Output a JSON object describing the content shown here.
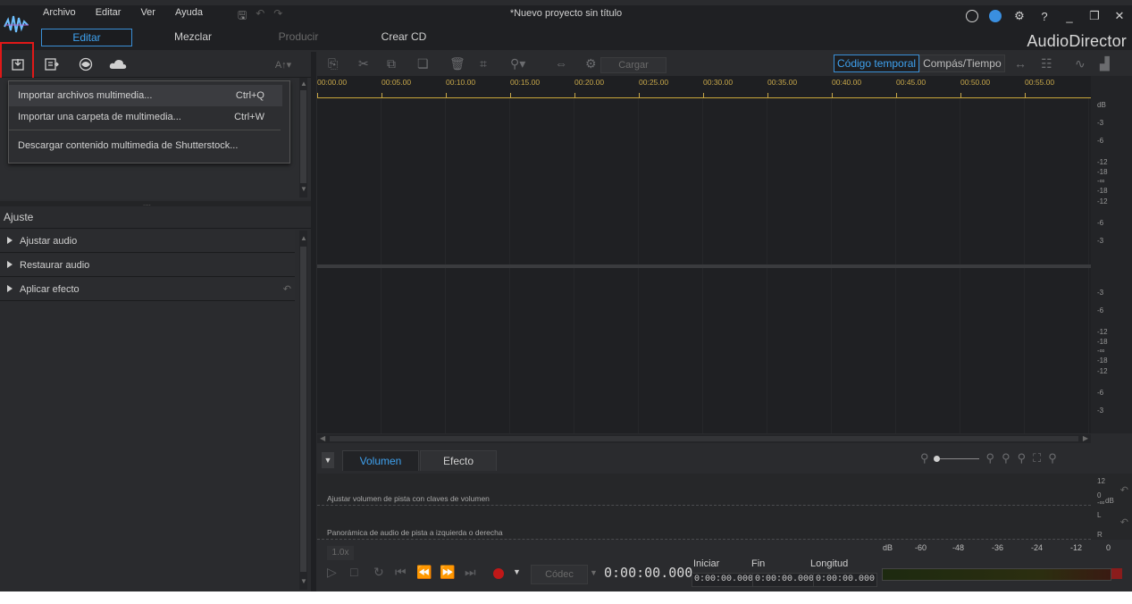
{
  "app": {
    "document_title": "*Nuevo proyecto sin título",
    "brand": "AudioDirector"
  },
  "menu": [
    "Archivo",
    "Editar",
    "Ver",
    "Ayuda"
  ],
  "mode_tabs": [
    {
      "label": "Editar",
      "state": "active"
    },
    {
      "label": "Mezclar",
      "state": "normal"
    },
    {
      "label": "Producir",
      "state": "disabled"
    },
    {
      "label": "Crear CD",
      "state": "normal"
    }
  ],
  "library_toolbar": {
    "text_style": "A↑▾"
  },
  "import_menu": {
    "items": [
      {
        "label": "Importar archivos multimedia...",
        "shortcut": "Ctrl+Q"
      },
      {
        "label": "Importar una carpeta de multimedia...",
        "shortcut": "Ctrl+W"
      },
      {
        "label": "Descargar contenido multimedia de Shutterstock...",
        "shortcut": ""
      }
    ]
  },
  "adjust_panel": {
    "title": "Ajuste",
    "rows": [
      "Ajustar audio",
      "Restaurar audio",
      "Aplicar efecto"
    ]
  },
  "editor_toolbar": {
    "load_label": "Cargar",
    "time_modes": [
      "Código temporal",
      "Compás/Tiempo"
    ],
    "active_time_mode": "Código temporal"
  },
  "ruler": {
    "ticks": [
      "00:00.00",
      "00:05.00",
      "00:10.00",
      "00:15.00",
      "00:20.00",
      "00:25.00",
      "00:30.00",
      "00:35.00",
      "00:40.00",
      "00:45.00",
      "00:50.00",
      "00:55.00"
    ]
  },
  "db_scale": {
    "unit": "dB",
    "track1": [
      "-3",
      "-6",
      "-12",
      "-18",
      "-∞",
      "-18",
      "-12",
      "-6",
      "-3"
    ],
    "track2": [
      "-3",
      "-6",
      "-12",
      "-18",
      "-∞",
      "-18",
      "-12",
      "-6",
      "-3"
    ]
  },
  "bottom_tabs": [
    "Volumen",
    "Efecto"
  ],
  "envelope": {
    "volume_label": "Ajustar volumen de pista con claves de volumen",
    "pan_label": "Panorámica de audio de pista a izquierda o derecha",
    "volume_scale": [
      "12",
      "0",
      "-∞",
      "dB"
    ],
    "pan_scale": [
      "L",
      "R"
    ]
  },
  "transport": {
    "speed": "1.0x",
    "codec": "Códec",
    "timecode": "0:00:00.000",
    "selection": {
      "start_label": "Iniciar",
      "end_label": "Fin",
      "length_label": "Longitud",
      "start": "0:00:00.000",
      "end": "0:00:00.000",
      "length": "0:00:00.000"
    }
  },
  "meter_scale": [
    "dB",
    "-60",
    "-48",
    "-36",
    "-24",
    "-12",
    "0"
  ],
  "colors": {
    "accent": "#3fa2f0",
    "record": "#c01818",
    "highlight": "#e01818",
    "ruler": "#c7a74a"
  }
}
